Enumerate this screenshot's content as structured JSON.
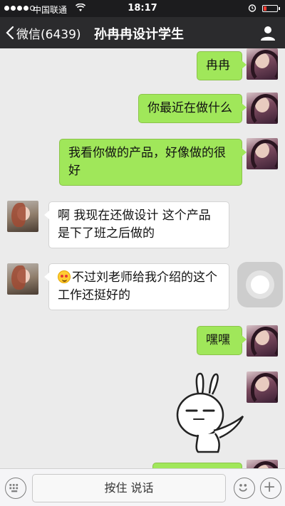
{
  "status_bar": {
    "carrier": "中国联通",
    "time": "18:17",
    "signal_strength_dots": 4,
    "signal_total_dots": 5,
    "battery_level": 0.15
  },
  "nav": {
    "back_label": "微信(6439)",
    "title": "孙冉冉设计学生"
  },
  "messages": [
    {
      "sender": "me",
      "text": "冉冉"
    },
    {
      "sender": "me",
      "text": "你最近在做什么"
    },
    {
      "sender": "me",
      "text": "我看你做的产品，好像做的很好"
    },
    {
      "sender": "friend",
      "text": "啊  我现在还做设计  这个产品是下了班之后做的"
    },
    {
      "sender": "friend",
      "emoji": "blush-emoji",
      "text": "不过刘老师给我介绍的这个工作还挺好的"
    },
    {
      "sender": "me",
      "text": "嘿嘿"
    },
    {
      "sender": "me",
      "type": "sticker",
      "sticker": "rabbit-sticker"
    }
  ],
  "input_bar": {
    "hold_to_talk_label": "按住 说话"
  },
  "colors": {
    "outgoing_bubble": "#a0e75a",
    "incoming_bubble": "#ffffff",
    "chat_background": "#ebebeb",
    "nav_background": "#2b2b2d"
  },
  "icons": [
    "wifi-icon",
    "alarm-icon",
    "battery-icon",
    "back-chevron-icon",
    "profile-icon",
    "keyboard-icon",
    "emoji-icon",
    "plus-icon"
  ]
}
